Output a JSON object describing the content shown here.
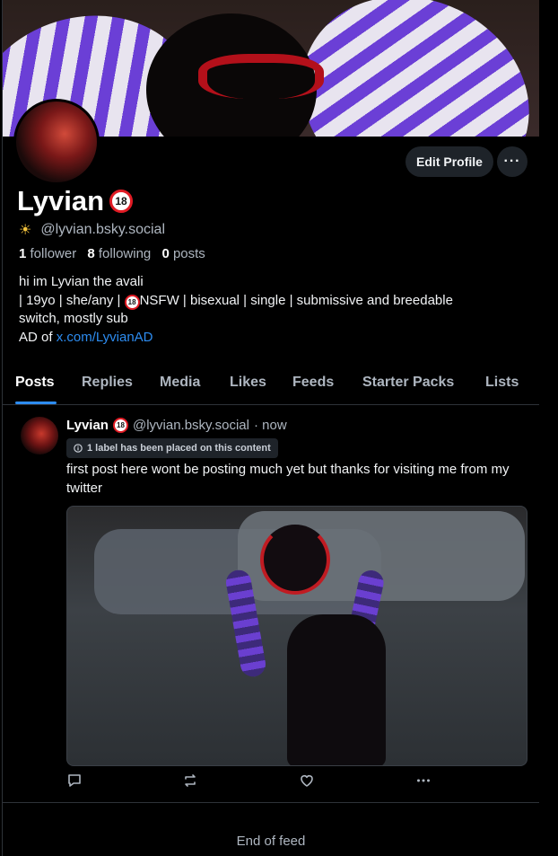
{
  "profile": {
    "display_name": "Lyvian",
    "badge": "18",
    "handle": "@lyvian.bsky.social",
    "followers_count": "1",
    "followers_label": "follower",
    "following_count": "8",
    "following_label": "following",
    "posts_count": "0",
    "posts_label": "posts",
    "bio_line1": "hi im Lyvian the avali",
    "bio_line2a": "| 19yo | she/any | ",
    "bio_line2b": "NSFW | bisexual | single | submissive and breedable",
    "bio_line3": "switch, mostly sub",
    "bio_line4_prefix": "AD of ",
    "bio_link": "x.com/LyvianAD"
  },
  "buttons": {
    "edit_profile": "Edit Profile",
    "more": "···"
  },
  "tabs": [
    "Posts",
    "Replies",
    "Media",
    "Likes",
    "Feeds",
    "Starter Packs",
    "Lists"
  ],
  "post": {
    "author": "Lyvian",
    "badge": "18",
    "handle": "@lyvian.bsky.social",
    "time": "· now",
    "label_notice": "1 label has been placed on this content",
    "text": "first post here wont be posting much yet but thanks for visiting me from my twitter"
  },
  "footer": {
    "end_of_feed": "End of feed"
  },
  "colors": {
    "accent": "#2d8cf0",
    "background": "#000000",
    "muted": "#aeb6c0",
    "badge_ring": "#e01b24"
  },
  "icons": [
    "sun-icon",
    "info-icon",
    "reply-icon",
    "repost-icon",
    "like-icon",
    "more-icon"
  ]
}
